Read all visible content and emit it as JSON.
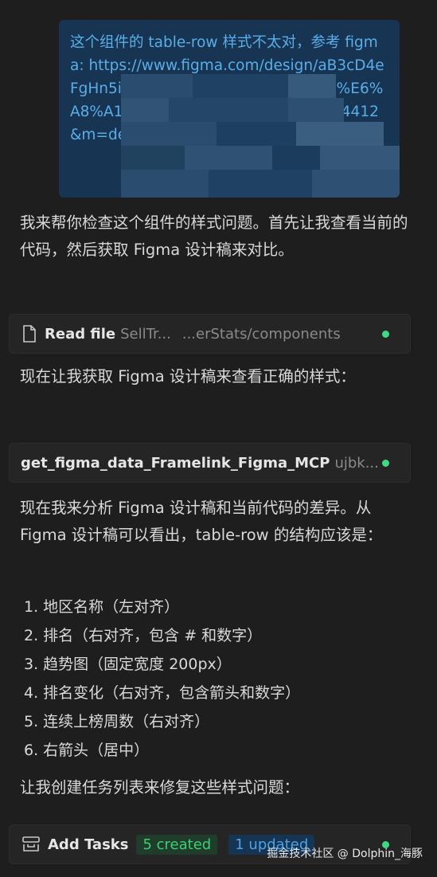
{
  "user_message": {
    "text": "这个组件的 table-row 样式不太对，参考 figma: https://www.figma.com/design/aB3cD4eFgHn5i8VWxYzA1B2C3D4E5F6Gh91%E6%A8%A1%E6%9D%BF?node-id=2083-4412&m=dev"
  },
  "assistant": {
    "p1": "我来帮你检查这个组件的样式问题。首先让我查看当前的代码，然后获取 Figma 设计稿来对比。",
    "tool1": {
      "icon": "file-icon",
      "name": "Read file",
      "detail": "SellTr...",
      "path": "...erStats/components"
    },
    "p2": "现在让我获取 Figma 设计稿来查看正确的样式：",
    "tool2": {
      "name": "get_figma_data_Framelink_Figma_MCP",
      "detail": "ujbk..."
    },
    "p3": "现在我来分析 Figma 设计稿和当前代码的差异。从 Figma 设计稿可以看出，table-row 的结构应该是：",
    "list": [
      "1. 地区名称（左对齐）",
      "2. 排名（右对齐，包含 # 和数字）",
      "3. 趋势图（固定宽度 200px）",
      "4. 排名变化（右对齐，包含箭头和数字）",
      "5. 连续上榜周数（右对齐）",
      "6. 右箭头（居中）"
    ],
    "p4": "让我创建任务列表来修复这些样式问题：",
    "tool3": {
      "icon": "tasks-icon",
      "name": "Add Tasks",
      "created": "5 created",
      "updated": "1 updated"
    }
  },
  "watermark": "掘金技术社区 @ Dolphin_海豚",
  "colors": {
    "background": "#1e1e1e",
    "user_bubble": "#173452",
    "link_text": "#5aaee8",
    "status_ok": "#3ddc84"
  }
}
